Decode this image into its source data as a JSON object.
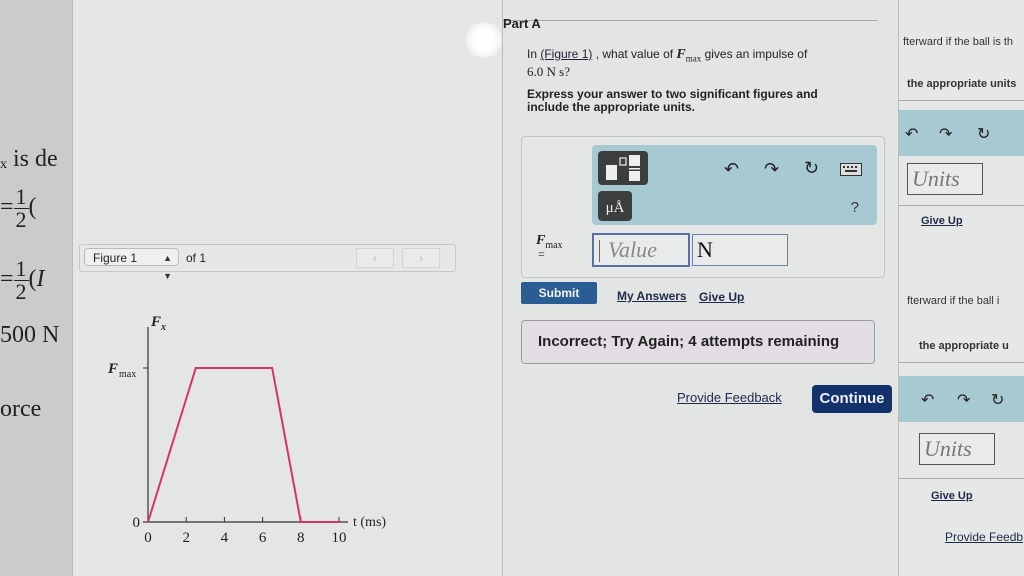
{
  "background_left": {
    "fragments": [
      "ₓ is de",
      "= 1/2 (",
      "= 1/2 (I",
      "500 N",
      "orce"
    ]
  },
  "figure_panel": {
    "selector_value": "Figure 1",
    "of_label": "of 1",
    "prev_icon": "chevron-left-icon",
    "next_icon": "chevron-right-icon"
  },
  "chart_data": {
    "type": "line",
    "title": "",
    "xlabel": "t (ms)",
    "ylabel": "F_x",
    "x_ticks": [
      0,
      2,
      4,
      6,
      8,
      10
    ],
    "y_tick_labels": [
      "0",
      "F_max"
    ],
    "xlim": [
      0,
      10
    ],
    "ylim": [
      0,
      1
    ],
    "series": [
      {
        "name": "F_x(t)",
        "color": "#d9345d",
        "x": [
          0,
          2.5,
          6.5,
          8,
          10
        ],
        "y": [
          0,
          1,
          1,
          0,
          0
        ],
        "y_units": "fraction of F_max"
      }
    ],
    "grid": false,
    "legend": "none"
  },
  "question": {
    "part_title": "Part A",
    "text_before_link": "In ",
    "link": "(Figure 1)",
    "text_mid": " , what value of ",
    "var_symbol": "F",
    "var_sub": "max",
    "text_after": " gives an impulse of",
    "impulse_value": "6.0 N s?",
    "instructions": "Express your answer to two significant figures and include the appropriate units."
  },
  "answer": {
    "toolbar": {
      "templates_icon": "templates-icon",
      "units_label": "μÅ",
      "undo_icon": "undo-icon",
      "redo_icon": "redo-icon",
      "reset_icon": "reset-icon",
      "keyboard_icon": "keyboard-icon",
      "help_label": "?"
    },
    "var_symbol": "F",
    "var_sub": "max",
    "equals": "=",
    "value_placeholder": "Value",
    "value": "",
    "unit_value": "N"
  },
  "actions": {
    "submit": "Submit",
    "my_answers": "My Answers",
    "give_up": "Give Up",
    "feedback_message": "Incorrect; Try Again; 4 attempts remaining",
    "provide_feedback": "Provide Feedback",
    "continue": "Continue"
  },
  "colors": {
    "submit_bg": "#2a5d93",
    "continue_bg": "#13316a",
    "toolbar_bg": "#a7c9d2",
    "chart_line": "#d9345d"
  },
  "background_right": {
    "line1": "fterward if the ball is th",
    "line2": "the appropriate units",
    "units_placeholder": "Units",
    "give_up": "Give Up",
    "line3": "fterward if the ball i",
    "line4": "the appropriate u",
    "units_placeholder_2": "Units",
    "give_up_2": "Give Up",
    "provide_feedback": "Provide Feedb"
  }
}
